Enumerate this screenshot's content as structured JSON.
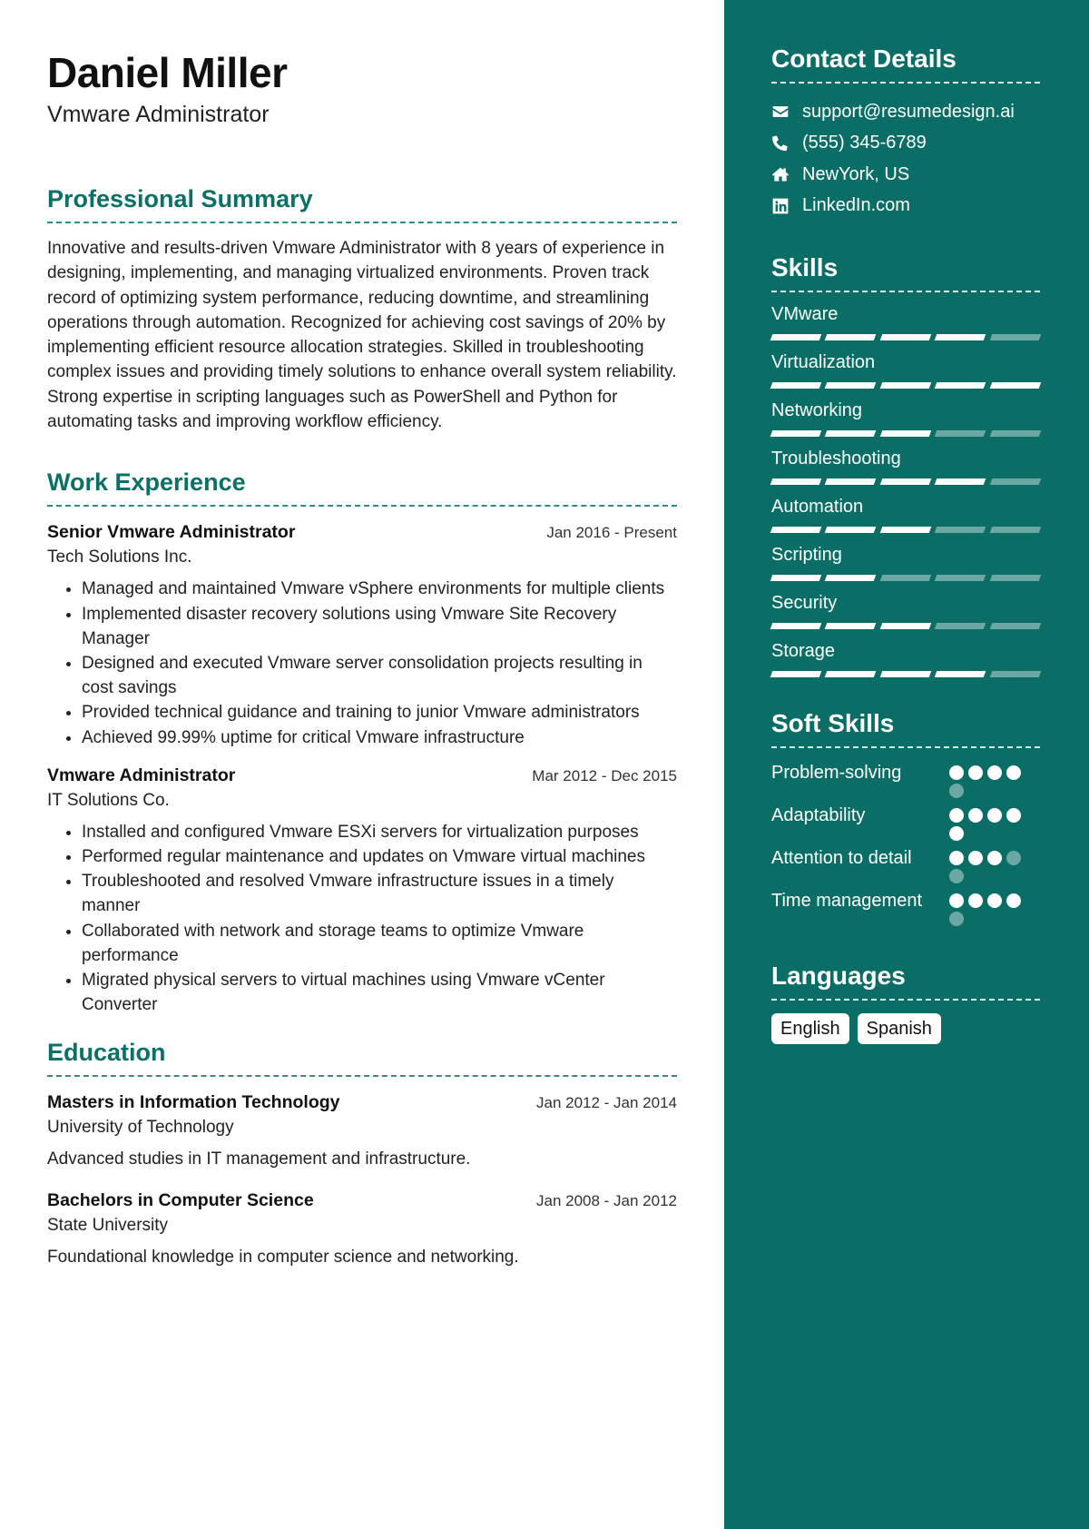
{
  "header": {
    "name": "Daniel Miller",
    "title": "Vmware Administrator"
  },
  "summary": {
    "heading": "Professional Summary",
    "text": "Innovative and results-driven Vmware Administrator with 8 years of experience in designing, implementing, and managing virtualized environments. Proven track record of optimizing system performance, reducing downtime, and streamlining operations through automation. Recognized for achieving cost savings of 20% by implementing efficient resource allocation strategies. Skilled in troubleshooting complex issues and providing timely solutions to enhance overall system reliability. Strong expertise in scripting languages such as PowerShell and Python for automating tasks and improving workflow efficiency."
  },
  "experience": {
    "heading": "Work Experience",
    "jobs": [
      {
        "title": "Senior Vmware Administrator",
        "date": "Jan 2016 - Present",
        "company": "Tech Solutions Inc.",
        "bullets": [
          "Managed and maintained Vmware vSphere environments for multiple clients",
          "Implemented disaster recovery solutions using Vmware Site Recovery Manager",
          "Designed and executed Vmware server consolidation projects resulting in cost savings",
          "Provided technical guidance and training to junior Vmware administrators",
          "Achieved 99.99% uptime for critical Vmware infrastructure"
        ]
      },
      {
        "title": "Vmware Administrator",
        "date": "Mar 2012 - Dec 2015",
        "company": "IT Solutions Co.",
        "bullets": [
          "Installed and configured Vmware ESXi servers for virtualization purposes",
          "Performed regular maintenance and updates on Vmware virtual machines",
          "Troubleshooted and resolved Vmware infrastructure issues in a timely manner",
          "Collaborated with network and storage teams to optimize Vmware performance",
          "Migrated physical servers to virtual machines using Vmware vCenter Converter"
        ]
      }
    ]
  },
  "education": {
    "heading": "Education",
    "items": [
      {
        "degree": "Masters in Information Technology",
        "date": "Jan 2012 - Jan 2014",
        "school": "University of Technology",
        "description": "Advanced studies in IT management and infrastructure."
      },
      {
        "degree": "Bachelors in Computer Science",
        "date": "Jan 2008 - Jan 2012",
        "school": "State University",
        "description": "Foundational knowledge in computer science and networking."
      }
    ]
  },
  "sidebar": {
    "colors": {
      "background": "#0b6e66",
      "accent": "#0b7066"
    },
    "contact": {
      "heading": "Contact Details",
      "items": [
        {
          "icon": "envelope-icon",
          "text": "support@resumedesign.ai"
        },
        {
          "icon": "phone-icon",
          "text": "(555) 345-6789"
        },
        {
          "icon": "home-icon",
          "text": "NewYork, US"
        },
        {
          "icon": "linkedin-icon",
          "text": "LinkedIn.com"
        }
      ]
    },
    "skills": {
      "heading": "Skills",
      "max": 5,
      "items": [
        {
          "name": "VMware",
          "level": 4
        },
        {
          "name": "Virtualization",
          "level": 5
        },
        {
          "name": "Networking",
          "level": 3
        },
        {
          "name": "Troubleshooting",
          "level": 4
        },
        {
          "name": "Automation",
          "level": 3
        },
        {
          "name": "Scripting",
          "level": 2
        },
        {
          "name": "Security",
          "level": 3
        },
        {
          "name": "Storage",
          "level": 4
        }
      ]
    },
    "soft_skills": {
      "heading": "Soft Skills",
      "max": 5,
      "items": [
        {
          "name": "Problem-solving",
          "level": 4
        },
        {
          "name": "Adaptability",
          "level": 5
        },
        {
          "name": "Attention to detail",
          "level": 3
        },
        {
          "name": "Time management",
          "level": 4
        }
      ]
    },
    "languages": {
      "heading": "Languages",
      "items": [
        "English",
        "Spanish"
      ]
    }
  }
}
